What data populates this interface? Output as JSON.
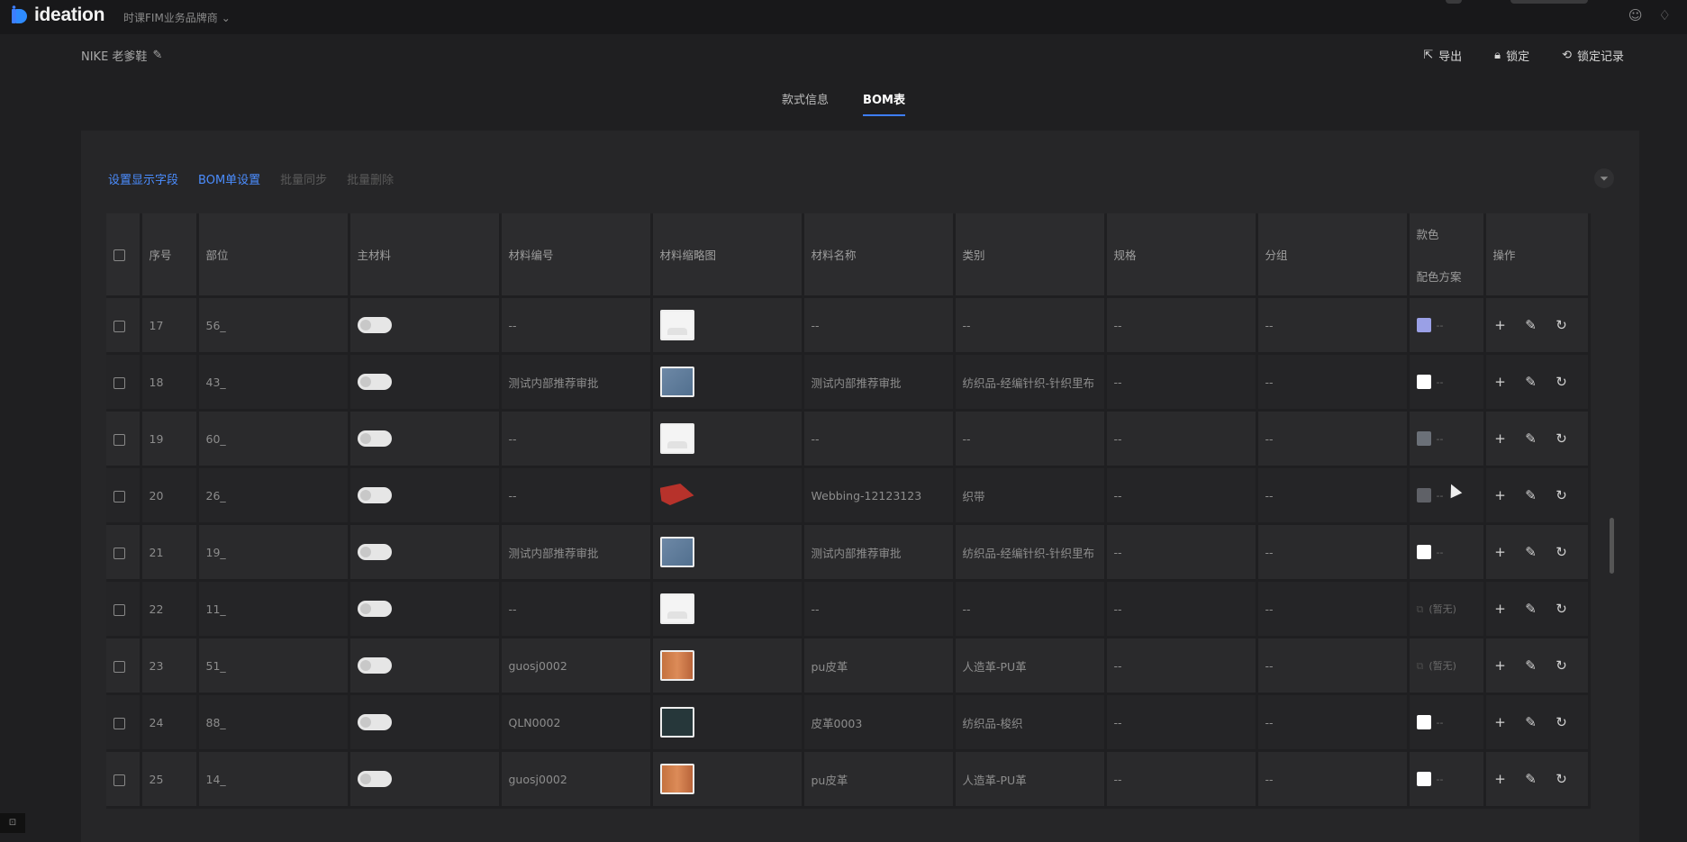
{
  "app": {
    "logo_text": "ideation",
    "brand_switch": "时课FIM业务品牌商",
    "brand_switch_arrow": "⌄"
  },
  "style_header": {
    "title": "NIKE 老爹鞋",
    "actions": [
      {
        "icon": "export-icon",
        "label": "导出"
      },
      {
        "icon": "lock-icon",
        "label": "锁定"
      },
      {
        "icon": "history-icon",
        "label": "锁定记录"
      }
    ]
  },
  "tabs": [
    {
      "label": "款式信息",
      "active": false
    },
    {
      "label": "BOM表",
      "active": true
    }
  ],
  "toolbar": [
    {
      "label": "设置显示字段",
      "enabled": true
    },
    {
      "label": "BOM单设置",
      "enabled": true
    },
    {
      "label": "批量同步",
      "enabled": false
    },
    {
      "label": "批量删除",
      "enabled": false
    }
  ],
  "columns": {
    "index": "序号",
    "part": "部位",
    "main_material": "主材料",
    "material_code": "材料编号",
    "thumbnail": "材料缩略图",
    "material_name": "材料名称",
    "category": "类别",
    "spec": "规格",
    "group": "分组",
    "color_line1": "款色",
    "color_line2": "配色方案",
    "actions": "操作"
  },
  "rows": [
    {
      "index": "17",
      "part": "56_",
      "code": "--",
      "thumb": "placeholder",
      "name": "--",
      "category": "--",
      "spec": "--",
      "group": "--",
      "color": "#9aa0e6",
      "color_text": "--"
    },
    {
      "index": "18",
      "part": "43_",
      "code": "测试内部推荐审批",
      "thumb": "blue-fabric",
      "name": "测试内部推荐审批",
      "category": "纺织品-经编针织-针织里布",
      "spec": "--",
      "group": "--",
      "color": "#ffffff",
      "color_text": "--"
    },
    {
      "index": "19",
      "part": "60_",
      "code": "--",
      "thumb": "placeholder",
      "name": "--",
      "category": "--",
      "spec": "--",
      "group": "--",
      "color": "#6b7078",
      "color_text": "--"
    },
    {
      "index": "20",
      "part": "26_",
      "code": "--",
      "thumb": "red-webbing",
      "name": "Webbing-12123123",
      "category": "织带",
      "spec": "--",
      "group": "--",
      "color": "#5f6167",
      "color_text": "--"
    },
    {
      "index": "21",
      "part": "19_",
      "code": "测试内部推荐审批",
      "thumb": "blue-fabric",
      "name": "测试内部推荐审批",
      "category": "纺织品-经编针织-针织里布",
      "spec": "--",
      "group": "--",
      "color": "#ffffff",
      "color_text": "--"
    },
    {
      "index": "22",
      "part": "11_",
      "code": "--",
      "thumb": "placeholder",
      "name": "--",
      "category": "--",
      "spec": "--",
      "group": "--",
      "color": "none",
      "color_text": "(暂无)"
    },
    {
      "index": "23",
      "part": "51_",
      "code": "guosj0002",
      "thumb": "orange-leather",
      "name": "pu皮革",
      "category": "人造革-PU革",
      "spec": "--",
      "group": "--",
      "color": "none",
      "color_text": "(暂无)"
    },
    {
      "index": "24",
      "part": "88_",
      "code": "QLN0002",
      "thumb": "dark-green",
      "name": "皮革0003",
      "category": "纺织品-梭织",
      "spec": "--",
      "group": "--",
      "color": "#ffffff",
      "color_text": "--"
    },
    {
      "index": "25",
      "part": "14_",
      "code": "guosj0002",
      "thumb": "orange-leather",
      "name": "pu皮革",
      "category": "人造革-PU革",
      "spec": "--",
      "group": "--",
      "color": "#ffffff",
      "color_text": "--"
    }
  ],
  "colors": {
    "accent": "#3d7eff",
    "link": "#4b8dff",
    "background": "#1f1f21"
  }
}
